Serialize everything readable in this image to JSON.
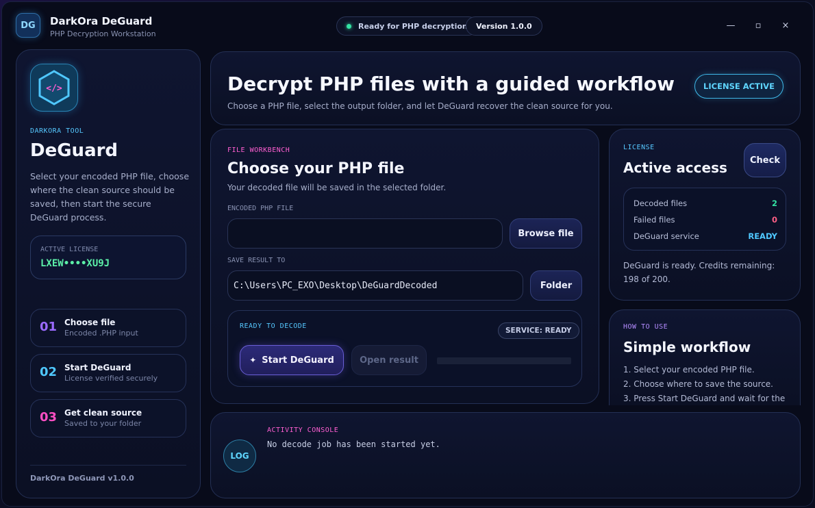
{
  "window": {
    "logo_text": "DG",
    "title": "DarkOra DeGuard",
    "subtitle": "PHP Decryption Workstation",
    "status_pill": "Ready for PHP decryption",
    "version_pill": "Version 1.0.0",
    "controls": {
      "minimize": "—",
      "maximize": "▫",
      "close": "×"
    }
  },
  "sidebar": {
    "logo_icon": "code-icon",
    "eyebrow": "DARKORA TOOL",
    "title": "DeGuard",
    "description": "Select your encoded PHP file, choose where the clean source should be saved, then start the secure DeGuard process.",
    "license": {
      "label": "ACTIVE LICENSE",
      "key": "LXEW••••XU9J"
    },
    "steps": [
      {
        "num": "01",
        "title": "Choose file",
        "sub": "Encoded .PHP input",
        "color": "#9b6bff"
      },
      {
        "num": "02",
        "title": "Start DeGuard",
        "sub": "License verified securely",
        "color": "#4fc8ff"
      },
      {
        "num": "03",
        "title": "Get clean source",
        "sub": "Saved to your folder",
        "color": "#ff4fc4"
      }
    ],
    "footer": "DarkOra DeGuard v1.0.0"
  },
  "hero": {
    "title": "Decrypt PHP files with a guided workflow",
    "subtitle": "Choose a PHP file, select the output folder, and let DeGuard recover the clean source for you.",
    "license_button": "LICENSE ACTIVE"
  },
  "workbench": {
    "eyebrow": "FILE WORKBENCH",
    "title": "Choose your PHP file",
    "subtitle": "Your decoded file will be saved in the selected folder.",
    "encoded_label": "ENCODED PHP FILE",
    "encoded_value": "",
    "browse_button": "Browse file",
    "save_label": "SAVE RESULT TO",
    "save_value": "C:\\Users\\PC_EXO\\Desktop\\DeGuardDecoded",
    "folder_button": "Folder",
    "decode": {
      "eyebrow": "READY TO DECODE",
      "service_status": "SERVICE: READY",
      "start_button": "Start DeGuard",
      "open_button": "Open result",
      "progress": 0
    }
  },
  "license_card": {
    "eyebrow": "LICENSE",
    "title": "Active access",
    "check_button": "Check",
    "stats": [
      {
        "label": "Decoded files",
        "value": "2",
        "color": "#34e3a4"
      },
      {
        "label": "Failed files",
        "value": "0",
        "color": "#ff5f86"
      },
      {
        "label": "DeGuard service",
        "value": "READY",
        "color": "#4fc8ff"
      }
    ],
    "note": "DeGuard is ready. Credits remaining: 198 of 200."
  },
  "howto": {
    "eyebrow": "HOW TO USE",
    "title": "Simple workflow",
    "steps": [
      "1. Select your encoded PHP file.",
      "2. Choose where to save the source.",
      "3. Press Start DeGuard and wait for the"
    ]
  },
  "console": {
    "badge": "LOG",
    "eyebrow": "ACTIVITY CONSOLE",
    "message": "No decode job has been started yet."
  }
}
